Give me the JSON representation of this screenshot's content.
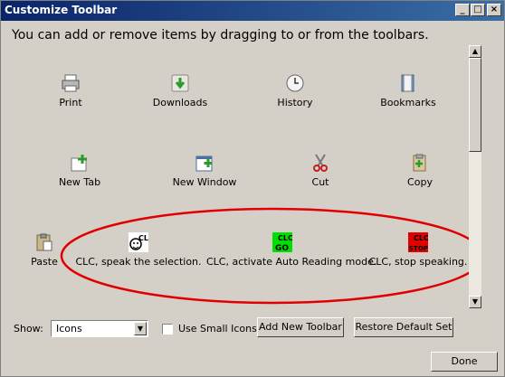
{
  "window": {
    "title": "Customize Toolbar"
  },
  "heading": "You can add or remove items by dragging to or from the toolbars.",
  "items": [
    {
      "label": "Print",
      "icon": "printer-icon"
    },
    {
      "label": "Downloads",
      "icon": "downloads-icon"
    },
    {
      "label": "History",
      "icon": "history-icon"
    },
    {
      "label": "Bookmarks",
      "icon": "bookmarks-icon"
    },
    {
      "label": "New Tab",
      "icon": "new-tab-icon"
    },
    {
      "label": "New Window",
      "icon": "new-window-icon"
    },
    {
      "label": "Cut",
      "icon": "scissors-icon"
    },
    {
      "label": "Copy",
      "icon": "copy-icon"
    },
    {
      "label": "Paste",
      "icon": "paste-icon"
    },
    {
      "label": "CLC, speak the selection.",
      "icon": "clc-speak-icon"
    },
    {
      "label": "CLC, activate Auto Reading mode.",
      "icon": "clc-go-icon"
    },
    {
      "label": "CLC, stop speaking.",
      "icon": "clc-stop-icon"
    }
  ],
  "controls": {
    "show_label": "Show:",
    "show_value": "Icons",
    "small_icons_label": "Use Small Icons",
    "add_toolbar": "Add New Toolbar",
    "restore": "Restore Default Set",
    "done": "Done"
  },
  "colors": {
    "titlebar": "#0a246a",
    "annotation": "#e00000",
    "go_bg": "#00e000",
    "stop_bg": "#e00000"
  }
}
